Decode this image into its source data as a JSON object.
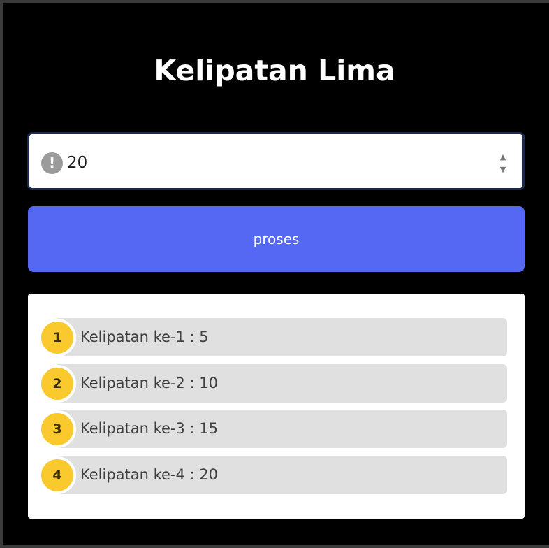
{
  "page": {
    "title": "Kelipatan Lima"
  },
  "input": {
    "value": "20",
    "warning_icon": "!",
    "spinner_up_icon": "▲",
    "spinner_down_icon": "▼"
  },
  "button": {
    "label": "proses"
  },
  "results": [
    {
      "number": "1",
      "text": "Kelipatan ke-1 : 5"
    },
    {
      "number": "2",
      "text": "Kelipatan ke-2 : 10"
    },
    {
      "number": "3",
      "text": "Kelipatan ke-3 : 15"
    },
    {
      "number": "4",
      "text": "Kelipatan ke-4 : 20"
    }
  ],
  "colors": {
    "background": "#000000",
    "button": "#5468f4",
    "badge": "#f9c92d",
    "item_bar": "#e0e0e0"
  }
}
